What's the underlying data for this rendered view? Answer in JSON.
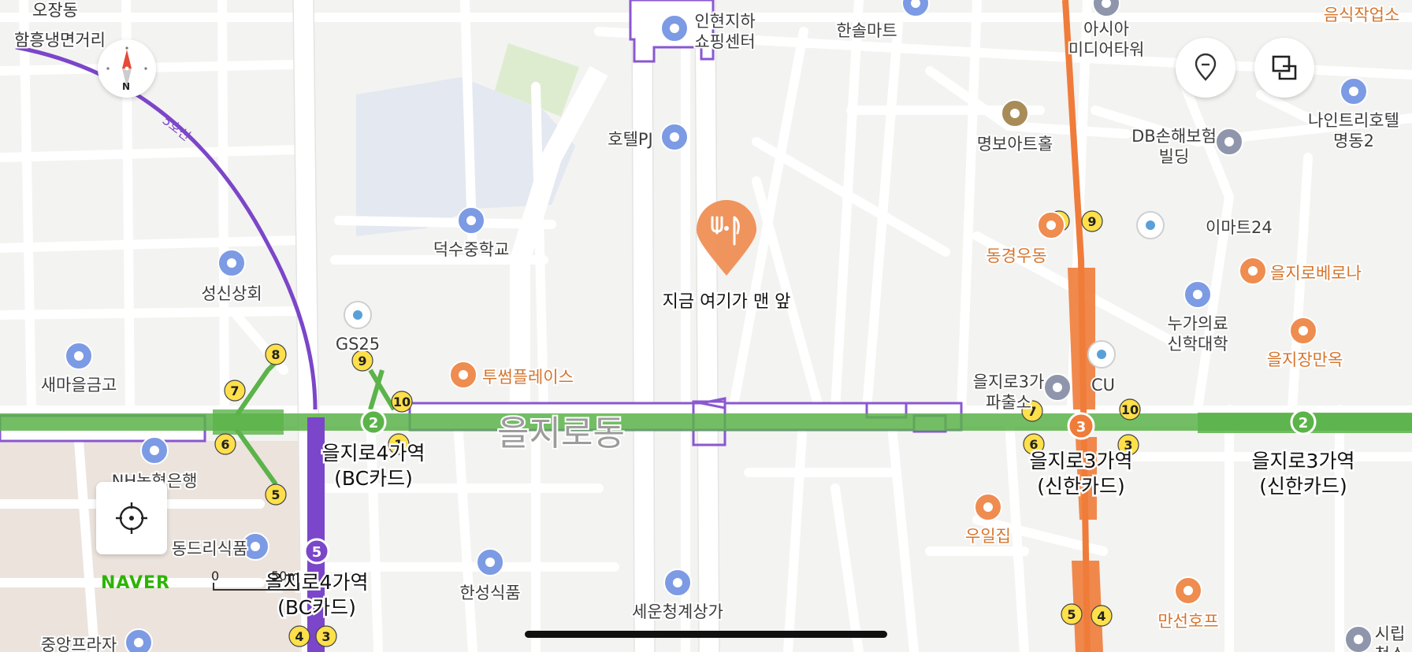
{
  "map": {
    "district_label": "을지로동",
    "destination": {
      "label": "지금 여기가 맨 앞",
      "icon": "restaurant-pin-icon"
    },
    "line_label": "5호선",
    "compass_label": "N",
    "brand": "NAVER",
    "scale": {
      "zero": "0",
      "distance": "50m"
    },
    "colors": {
      "line2": "#5bb34a",
      "line3": "#ef7c3a",
      "line5": "#7b46c9",
      "poi_blue": "#7c9be4",
      "poi_orange": "#ef8c4f",
      "station_yellow": "#ffe04a"
    }
  },
  "stations": [
    {
      "name": "을지로4가역\n(BC카드)",
      "line": "2"
    },
    {
      "name": "을지로4가역\n(BC카드)",
      "line": "5"
    },
    {
      "name": "을지로3가역\n(신한카드)",
      "line": "3"
    },
    {
      "name": "을지로3가역\n(신한카드)",
      "line": "2"
    }
  ],
  "exits": [
    "8",
    "7",
    "6",
    "5",
    "9",
    "10",
    "1",
    "4",
    "3",
    "7",
    "6",
    "3",
    "10",
    "8",
    "9",
    "5",
    "4"
  ],
  "places": [
    {
      "name": "오장동",
      "kind": "area"
    },
    {
      "name": "함흥냉면거리",
      "kind": "area"
    },
    {
      "name": "인현지하\n쇼핑센터",
      "kind": "shopping"
    },
    {
      "name": "한솔마트",
      "kind": "shopping"
    },
    {
      "name": "아시아\n미디어타워",
      "kind": "building"
    },
    {
      "name": "음식작업소",
      "kind": "food"
    },
    {
      "name": "호텔PJ",
      "kind": "hotel"
    },
    {
      "name": "명보아트홀",
      "kind": "culture"
    },
    {
      "name": "DB손해보험\n빌딩",
      "kind": "building"
    },
    {
      "name": "나인트리호텔\n명동2",
      "kind": "hotel"
    },
    {
      "name": "덕수중학교",
      "kind": "school"
    },
    {
      "name": "동경우동",
      "kind": "food"
    },
    {
      "name": "이마트24",
      "kind": "convenience"
    },
    {
      "name": "을지로베로나",
      "kind": "cafe"
    },
    {
      "name": "성신상회",
      "kind": "shopping"
    },
    {
      "name": "GS25",
      "kind": "convenience"
    },
    {
      "name": "누가의료\n신학대학",
      "kind": "school"
    },
    {
      "name": "을지장만옥",
      "kind": "food"
    },
    {
      "name": "새마을금고",
      "kind": "bank"
    },
    {
      "name": "투썸플레이스",
      "kind": "cafe"
    },
    {
      "name": "을지로3가\n파출소",
      "kind": "police"
    },
    {
      "name": "CU",
      "kind": "convenience"
    },
    {
      "name": "NH농협은행",
      "kind": "bank"
    },
    {
      "name": "우일집",
      "kind": "food"
    },
    {
      "name": "동드리식품",
      "kind": "shopping"
    },
    {
      "name": "한성식품",
      "kind": "shopping"
    },
    {
      "name": "세운청계상가",
      "kind": "shopping"
    },
    {
      "name": "만선호프",
      "kind": "pub"
    },
    {
      "name": "중앙프라자",
      "kind": "shopping"
    },
    {
      "name": "시립\n청소",
      "kind": "building"
    }
  ],
  "controls": {
    "compass": "compass-button",
    "location": "current-location-button",
    "pin": "place-pin-button",
    "layers": "map-layers-button"
  }
}
